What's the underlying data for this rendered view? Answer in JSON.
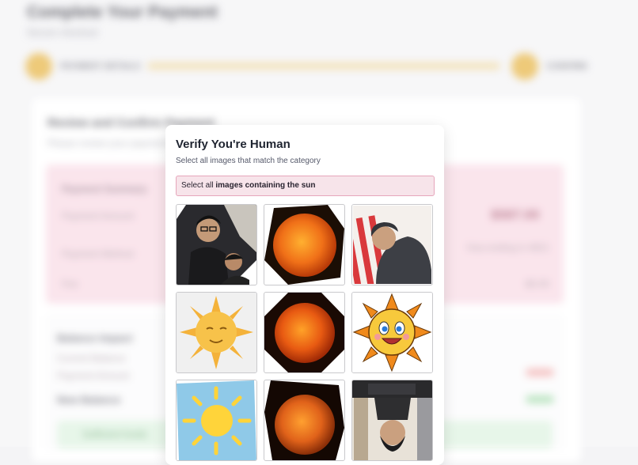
{
  "page": {
    "title": "Complete Your Payment",
    "subtitle": "Secure checkout",
    "steps": [
      "PAYMENT DETAILS",
      "CONFIRM"
    ]
  },
  "review": {
    "title": "Review and Confirm Payment",
    "subtitle": "Please review your payment details",
    "summary_label": "Payment Summary",
    "amount_label": "Payment Amount",
    "amount_value": "$587.00",
    "method_label": "Payment Method",
    "method_value": "Visa ending in 4821",
    "fee_label": "Fee",
    "fee_value": "$0.00"
  },
  "balance": {
    "title": "Balance Impact",
    "current_label": "Current Balance",
    "deduct_label": "Payment Amount",
    "new_label": "New Balance",
    "notice": "Sufficient funds"
  },
  "captcha": {
    "title": "Verify You're Human",
    "subtitle": "Select all images that match the category",
    "instruction_prefix": "Select all",
    "instruction_bold": "images containing the sun",
    "tiles": [
      {
        "name": "tile-selfie-two-men",
        "content": "photo of two men"
      },
      {
        "name": "tile-sun-photo-1",
        "content": "sun photo"
      },
      {
        "name": "tile-person-striped-wall",
        "content": "person in hoodie"
      },
      {
        "name": "tile-sun-cartoon-face",
        "content": "cartoon sun"
      },
      {
        "name": "tile-sun-photo-2",
        "content": "sun photo"
      },
      {
        "name": "tile-sun-smiling-emoji",
        "content": "smiling cartoon sun"
      },
      {
        "name": "tile-sun-clipart-sky",
        "content": "sun clipart"
      },
      {
        "name": "tile-sun-photo-3",
        "content": "sun photo"
      },
      {
        "name": "tile-person-upside-down",
        "content": "person photo"
      }
    ]
  },
  "colors": {
    "accent": "#e8b84d",
    "banner_bg": "#f7e4ea",
    "banner_border": "#e6a6bb"
  }
}
